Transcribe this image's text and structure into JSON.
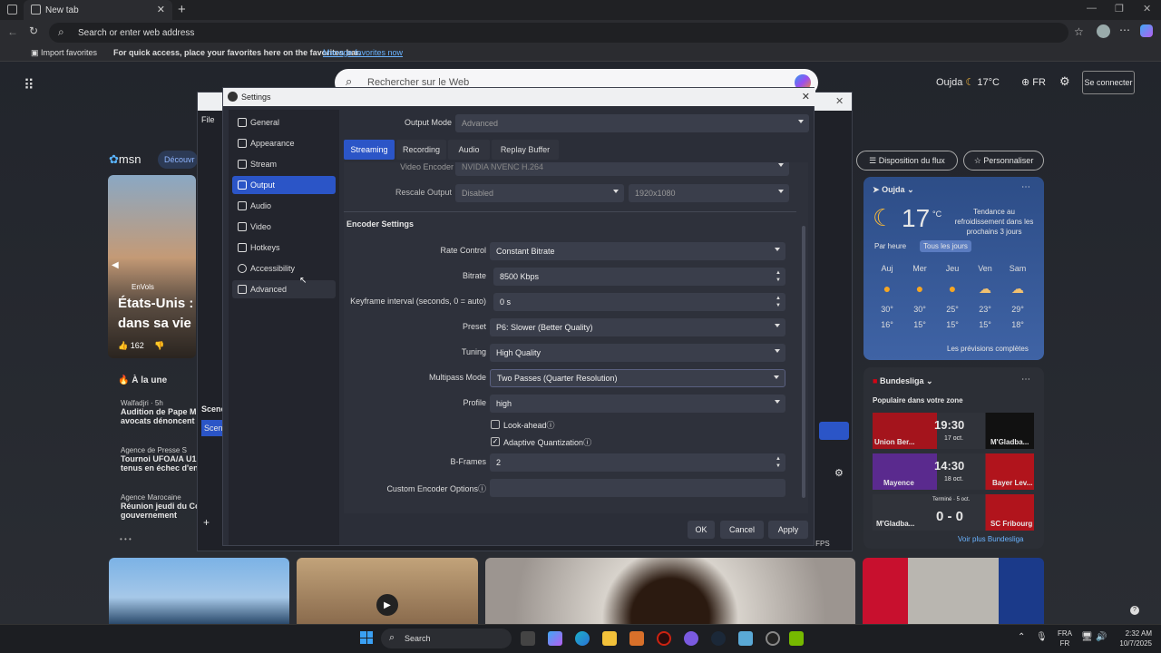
{
  "browser": {
    "tab_title": "New tab",
    "address_placeholder": "Search or enter web address",
    "fav_import": "Import favorites",
    "fav_hint": "For quick access, place your favorites here on the favorites bar.",
    "fav_manage": "Manage favorites now"
  },
  "msn": {
    "logo": "msn",
    "discover": "Découvr",
    "search_placeholder": "Rechercher sur le Web",
    "city": "Oujda",
    "temp_top": "17°C",
    "lang": "FR",
    "signin": "Se connecter",
    "flux": "Disposition du flux",
    "personalize": "Personnaliser",
    "hero_source": "EnVols",
    "hero_title_1": "États-Unis :",
    "hero_title_2": "dans sa vie",
    "hero_likes": "162",
    "alaune": "À la une",
    "news": [
      {
        "source": "Walfadjri · 5h",
        "t1": "Audition de Pape M",
        "t2": "avocats dénoncent"
      },
      {
        "source": "Agence de Presse S",
        "t1": "Tournoi UFOA/A U1",
        "t2": "tenus en échec d'en"
      },
      {
        "source": "Agence Marocaine",
        "t1": "Réunion jeudi du Co",
        "t2": "gouvernement"
      }
    ],
    "weather": {
      "city": "Oujda",
      "temp": "17",
      "unit": "°C",
      "trend": "Tendance au refroidissement dans les prochains 3 jours",
      "tab_hour": "Par heure",
      "tab_days": "Tous les jours",
      "days": [
        {
          "d": "Auj",
          "hi": "30°",
          "lo": "16°"
        },
        {
          "d": "Mer",
          "hi": "30°",
          "lo": "15°"
        },
        {
          "d": "Jeu",
          "hi": "25°",
          "lo": "15°"
        },
        {
          "d": "Ven",
          "hi": "23°",
          "lo": "15°"
        },
        {
          "d": "Sam",
          "hi": "29°",
          "lo": "18°"
        }
      ],
      "more": "Les prévisions complètes"
    },
    "bundesliga": {
      "title": "Bundesliga",
      "subtitle": "Populaire dans votre zone",
      "matches": [
        {
          "home": "Union Ber...",
          "away": "M'Gladba...",
          "score": "19:30",
          "date": "17 oct."
        },
        {
          "home": "Mayence",
          "away": "Bayer Lev...",
          "score": "14:30",
          "date": "18 oct."
        },
        {
          "home": "M'Gladba...",
          "away": "SC Fribourg",
          "score": "0 - 0",
          "date": "Terminé · 5 oct."
        }
      ],
      "more": "Voir plus Bundesliga"
    }
  },
  "obs_bg": {
    "file": "File",
    "scenes": "Scene",
    "scene_item": "Scen",
    "fps": "40 FPS"
  },
  "settings": {
    "title": "Settings",
    "nav": [
      "General",
      "Appearance",
      "Stream",
      "Output",
      "Audio",
      "Video",
      "Hotkeys",
      "Accessibility",
      "Advanced"
    ],
    "selected_nav": "Output",
    "output_mode_label": "Output Mode",
    "output_mode_value": "Advanced",
    "tabs": [
      "Streaming",
      "Recording",
      "Audio",
      "Replay Buffer"
    ],
    "video_encoder_label": "Video Encoder",
    "video_encoder_value": "NVIDIA NVENC H.264",
    "rescale_label": "Rescale Output",
    "rescale_value": "Disabled",
    "rescale_res": "1920x1080",
    "encoder_settings": "Encoder Settings",
    "rate_control_label": "Rate Control",
    "rate_control_value": "Constant Bitrate",
    "bitrate_label": "Bitrate",
    "bitrate_value": "8500 Kbps",
    "keyframe_label": "Keyframe interval (seconds, 0 = auto)",
    "keyframe_value": "0 s",
    "preset_label": "Preset",
    "preset_value": "P6: Slower (Better Quality)",
    "tuning_label": "Tuning",
    "tuning_value": "High Quality",
    "multipass_label": "Multipass Mode",
    "multipass_value": "Two Passes (Quarter Resolution)",
    "profile_label": "Profile",
    "profile_value": "high",
    "lookahead_label": "Look-ahead",
    "lookahead_checked": false,
    "aq_label": "Adaptive Quantization",
    "aq_checked": true,
    "bframes_label": "B-Frames",
    "bframes_value": "2",
    "custom_label": "Custom Encoder Options",
    "custom_value": "",
    "ok": "OK",
    "cancel": "Cancel",
    "apply": "Apply"
  },
  "taskbar": {
    "search": "Search",
    "lang1": "FRA",
    "lang2": "FR",
    "time": "2:32 AM",
    "date": "10/7/2025"
  }
}
